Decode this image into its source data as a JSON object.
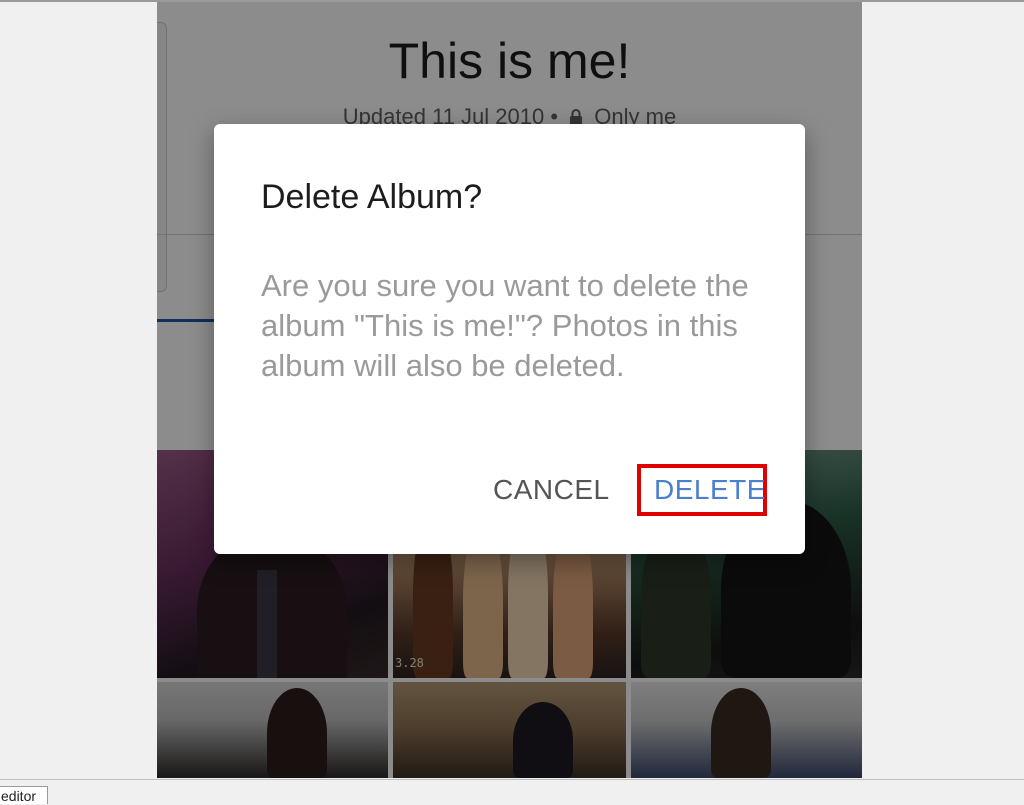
{
  "album": {
    "title": "This is me!",
    "updated": "Updated 11 Jul 2010 •",
    "privacy": "Only me",
    "icons": {
      "privacy": "lock-icon"
    }
  },
  "photos": [
    {
      "name": "photo-1"
    },
    {
      "name": "photo-2",
      "date_stamp": "3.28"
    },
    {
      "name": "photo-3"
    },
    {
      "name": "photo-4"
    },
    {
      "name": "photo-5"
    },
    {
      "name": "photo-6"
    }
  ],
  "dialog": {
    "title": "Delete Album?",
    "message": "Are you sure you want to delete the album \"This is me!\"? Photos in this album will also be deleted.",
    "cancel_label": "CANCEL",
    "delete_label": "DELETE"
  },
  "taskbar": {
    "tab_label": "editor"
  },
  "colors": {
    "delete_accent": "#4a7fd0",
    "highlight_box": "#e00000",
    "message_text": "#9a9a9a",
    "tab_underline": "#1c56a8"
  }
}
